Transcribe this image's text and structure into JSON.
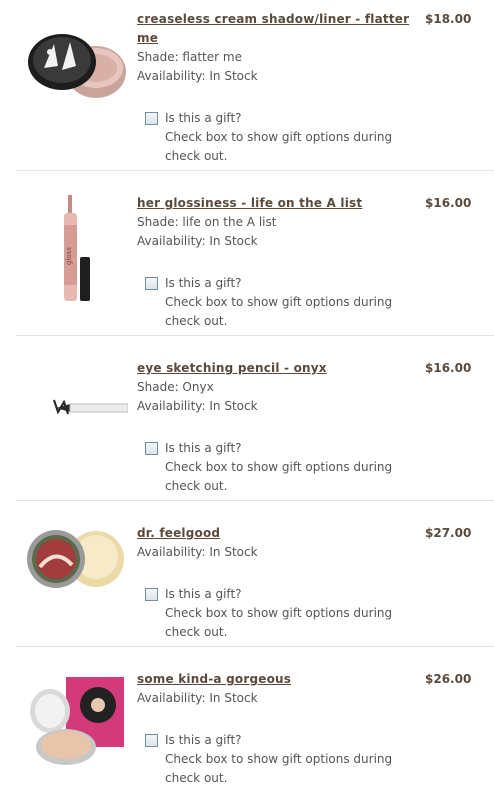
{
  "cart": {
    "items": [
      {
        "title": "creaseless cream shadow/liner - flatter me",
        "price": "$18.00",
        "shade": "Shade: flatter me",
        "availability": "Availability: In Stock",
        "gift_question": "Is this a gift?",
        "gift_note": "Check box to show gift options during check out.",
        "image": "cream-shadow-pot"
      },
      {
        "title": "her glossiness - life on the A list",
        "price": "$16.00",
        "shade": "Shade: life on the A list",
        "availability": "Availability: In Stock",
        "gift_question": "Is this a gift?",
        "gift_note": "Check box to show gift options during check out.",
        "image": "lip-gloss-tube"
      },
      {
        "title": "eye sketching pencil - onyx",
        "price": "$16.00",
        "shade": "Shade: Onyx",
        "availability": "Availability: In Stock",
        "gift_question": "Is this a gift?",
        "gift_note": "Check box to show gift options during check out.",
        "image": "eye-pencil"
      },
      {
        "title": "dr. feelgood",
        "price": "$27.00",
        "availability": "Availability: In Stock",
        "gift_question": "Is this a gift?",
        "gift_note": "Check box to show gift options during check out.",
        "image": "balm-compact"
      },
      {
        "title": "some kind-a gorgeous",
        "price": "$26.00",
        "availability": "Availability: In Stock",
        "gift_question": "Is this a gift?",
        "gift_note": "Check box to show gift options during check out.",
        "image": "foundation-compact-box"
      }
    ]
  },
  "colors": {
    "title": "#5b4a3c",
    "text": "#555555",
    "checkbox_border": "#6e8da8"
  }
}
